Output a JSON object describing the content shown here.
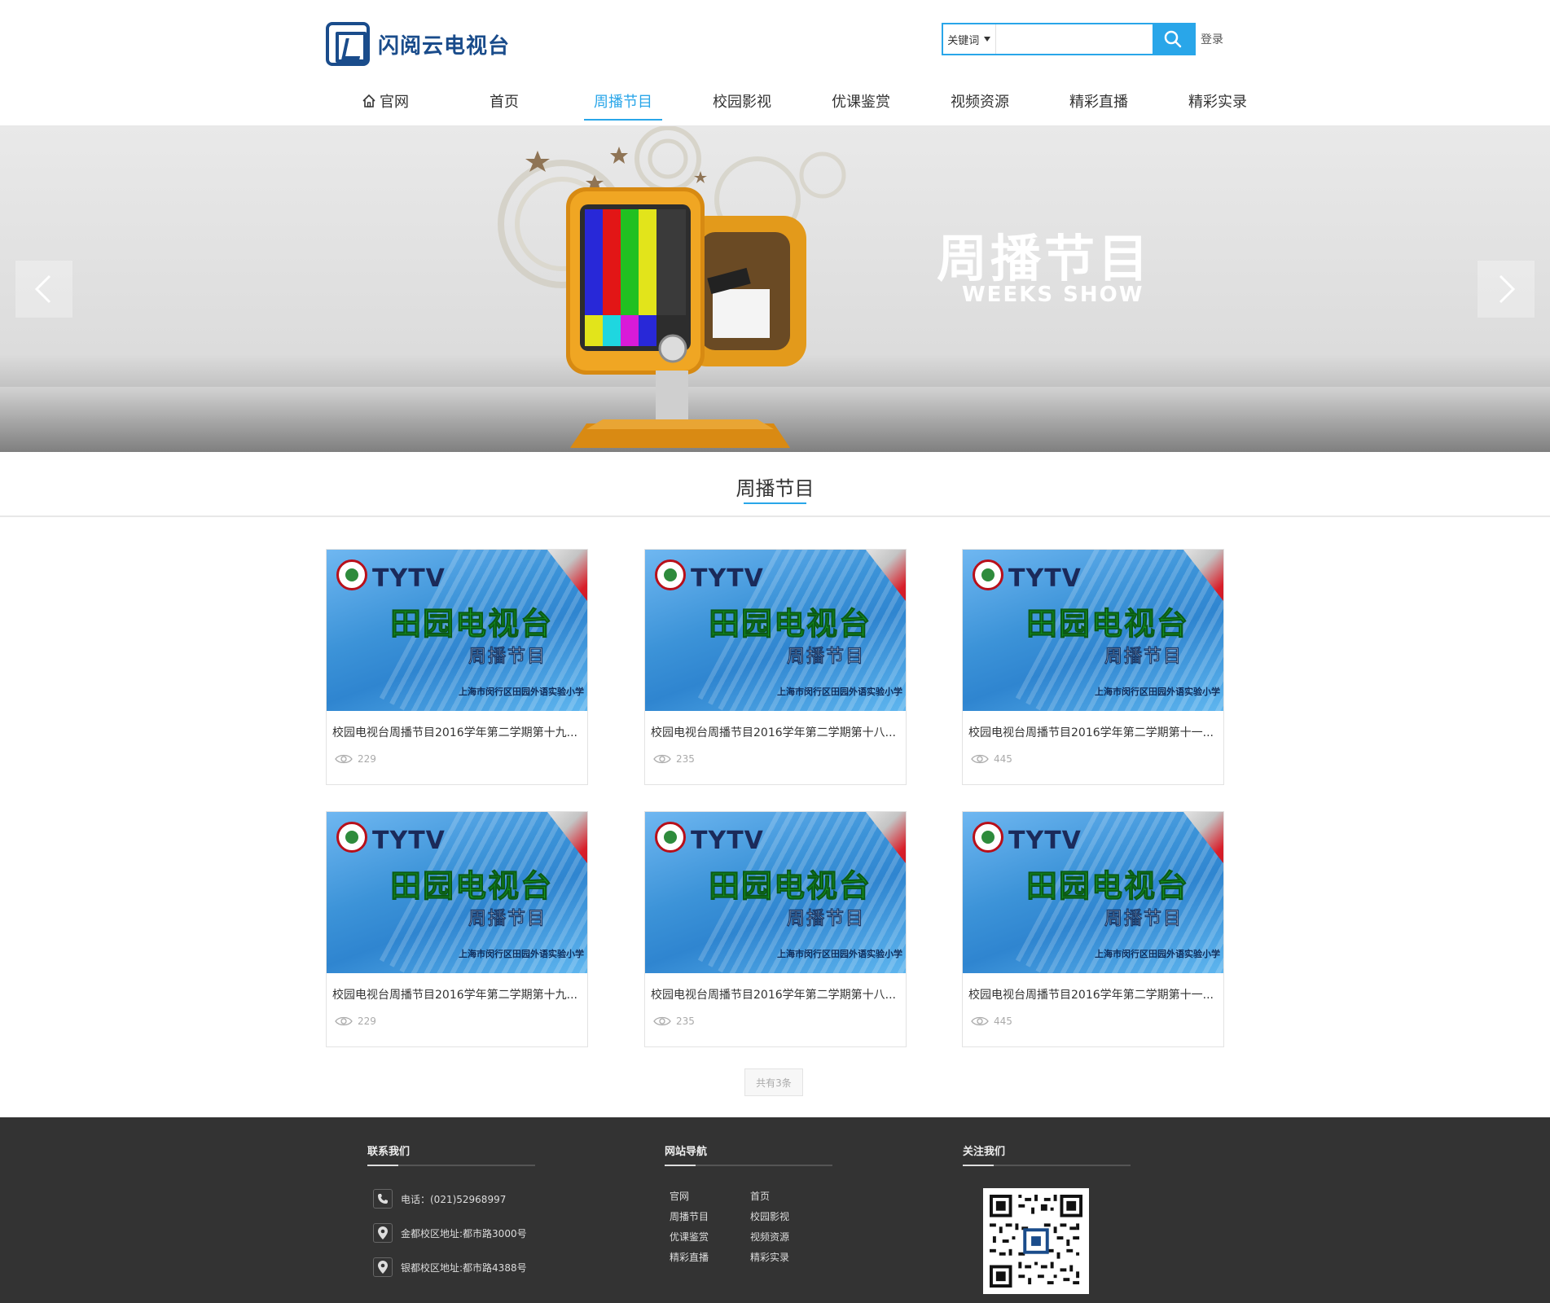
{
  "header": {
    "logo_text": "闪阅云电视台",
    "search": {
      "select_label": "关键词",
      "placeholder": ""
    },
    "login_label": "登录",
    "nav": [
      {
        "label": "官网"
      },
      {
        "label": "首页"
      },
      {
        "label": "周播节目"
      },
      {
        "label": "校园影视"
      },
      {
        "label": "优课鉴赏"
      },
      {
        "label": "视频资源"
      },
      {
        "label": "精彩直播"
      },
      {
        "label": "精彩实录"
      }
    ],
    "active_nav": "周播节目"
  },
  "banner": {
    "title": "周播节目",
    "subtitle": "WEEKS SHOW"
  },
  "section": {
    "title": "周播节目"
  },
  "videos": [
    {
      "title": "校园电视台周播节目2016学年第二学期第十九...",
      "views": "229",
      "thumb_tytv": "TYTV",
      "thumb_main": "田园电视台",
      "thumb_sub": "周播节目",
      "thumb_school": "上海市闵行区田园外语实验小学"
    },
    {
      "title": "校园电视台周播节目2016学年第二学期第十八...",
      "views": "235",
      "thumb_tytv": "TYTV",
      "thumb_main": "田园电视台",
      "thumb_sub": "周播节目",
      "thumb_school": "上海市闵行区田园外语实验小学"
    },
    {
      "title": "校园电视台周播节目2016学年第二学期第十一...",
      "views": "445",
      "thumb_tytv": "TYTV",
      "thumb_main": "田园电视台",
      "thumb_sub": "周播节目",
      "thumb_school": "上海市闵行区田园外语实验小学"
    },
    {
      "title": "校园电视台周播节目2016学年第二学期第十九...",
      "views": "229",
      "thumb_tytv": "TYTV",
      "thumb_main": "田园电视台",
      "thumb_sub": "周播节目",
      "thumb_school": "上海市闵行区田园外语实验小学"
    },
    {
      "title": "校园电视台周播节目2016学年第二学期第十八...",
      "views": "235",
      "thumb_tytv": "TYTV",
      "thumb_main": "田园电视台",
      "thumb_sub": "周播节目",
      "thumb_school": "上海市闵行区田园外语实验小学"
    },
    {
      "title": "校园电视台周播节目2016学年第二学期第十一...",
      "views": "445",
      "thumb_tytv": "TYTV",
      "thumb_main": "田园电视台",
      "thumb_sub": "周播节目",
      "thumb_school": "上海市闵行区田园外语实验小学"
    }
  ],
  "pager": {
    "label": "共有3条"
  },
  "footer": {
    "contact": {
      "title": "联系我们",
      "phone": "电话：(021)52968997",
      "address1": "金都校区地址:都市路3000号",
      "address2": "银都校区地址:都市路4388号"
    },
    "site_nav": {
      "title": "网站导航",
      "links": [
        "官网",
        "首页",
        "周播节目",
        "校园影视",
        "优课鉴赏",
        "视频资源",
        "精彩直播",
        "精彩实录"
      ]
    },
    "follow": {
      "title": "关注我们"
    }
  },
  "colors": {
    "accent": "#29a6e9",
    "logo": "#1a4c8b",
    "footer_bg": "#333333"
  }
}
